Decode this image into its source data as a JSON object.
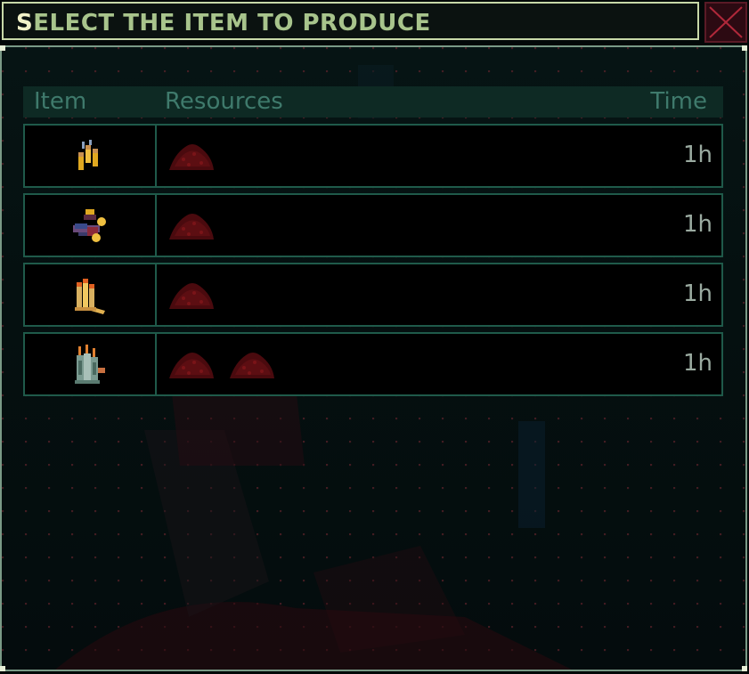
{
  "dialog": {
    "title_first": "S",
    "title_rest": "ELECT THE ITEM TO PRODUCE",
    "close_icon": "close-x-icon"
  },
  "table": {
    "headers": {
      "item": "Item",
      "resources": "Resources",
      "time": "Time"
    },
    "rows": [
      {
        "item_icon": "ammo-cartridges-icon",
        "resource_icon": "red-ore-pile-icon",
        "resource_count": 1,
        "time": "1h"
      },
      {
        "item_icon": "grenade-launcher-icon",
        "resource_icon": "red-ore-pile-icon",
        "resource_count": 1,
        "time": "1h"
      },
      {
        "item_icon": "shells-icon",
        "resource_icon": "red-ore-pile-icon",
        "resource_count": 1,
        "time": "1h"
      },
      {
        "item_icon": "rocket-canisters-icon",
        "resource_icon": "red-ore-pile-icon",
        "resource_count": 2,
        "time": "1h"
      }
    ]
  },
  "colors": {
    "title_text": "#a8c48c",
    "header_text": "#3f7a6c",
    "row_border": "#1f5a4a",
    "close_accent": "#b0283a"
  }
}
